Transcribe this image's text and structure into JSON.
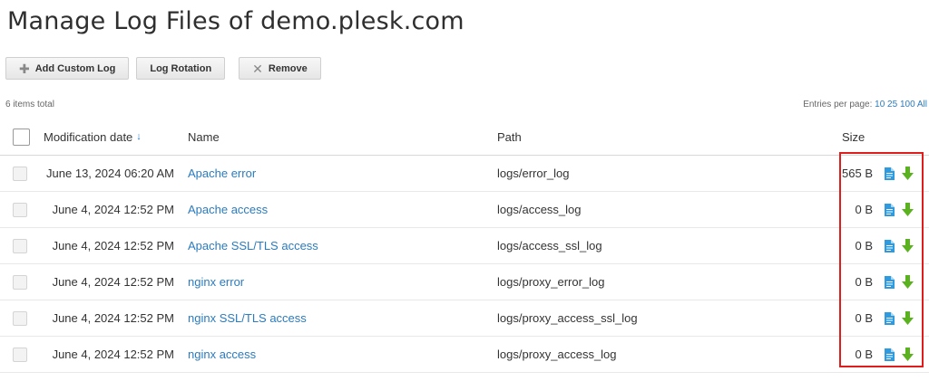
{
  "page": {
    "title": "Manage Log Files of demo.plesk.com"
  },
  "toolbar": {
    "add_label": "Add Custom Log",
    "rotation_label": "Log Rotation",
    "remove_label": "Remove"
  },
  "list": {
    "count_label": "6 items total",
    "per_page_label": "Entries per page:",
    "per_page_options": [
      "10",
      "25",
      "100",
      "All"
    ]
  },
  "columns": {
    "date": "Modification date",
    "sort_indicator": "↓",
    "name": "Name",
    "path": "Path",
    "size": "Size"
  },
  "rows": [
    {
      "date": "June 13, 2024 06:20 AM",
      "name": "Apache error",
      "path": "logs/error_log",
      "size": "565 B"
    },
    {
      "date": "June 4, 2024 12:52 PM",
      "name": "Apache access",
      "path": "logs/access_log",
      "size": "0 B"
    },
    {
      "date": "June 4, 2024 12:52 PM",
      "name": "Apache SSL/TLS access",
      "path": "logs/access_ssl_log",
      "size": "0 B"
    },
    {
      "date": "June 4, 2024 12:52 PM",
      "name": "nginx error",
      "path": "logs/proxy_error_log",
      "size": "0 B"
    },
    {
      "date": "June 4, 2024 12:52 PM",
      "name": "nginx SSL/TLS access",
      "path": "logs/proxy_access_ssl_log",
      "size": "0 B"
    },
    {
      "date": "June 4, 2024 12:52 PM",
      "name": "nginx access",
      "path": "logs/proxy_access_log",
      "size": "0 B"
    }
  ],
  "colors": {
    "link": "#2a7bbf",
    "view_icon": "#2e9be0",
    "download_icon": "#5ab21e",
    "highlight": "#e01d1d"
  }
}
